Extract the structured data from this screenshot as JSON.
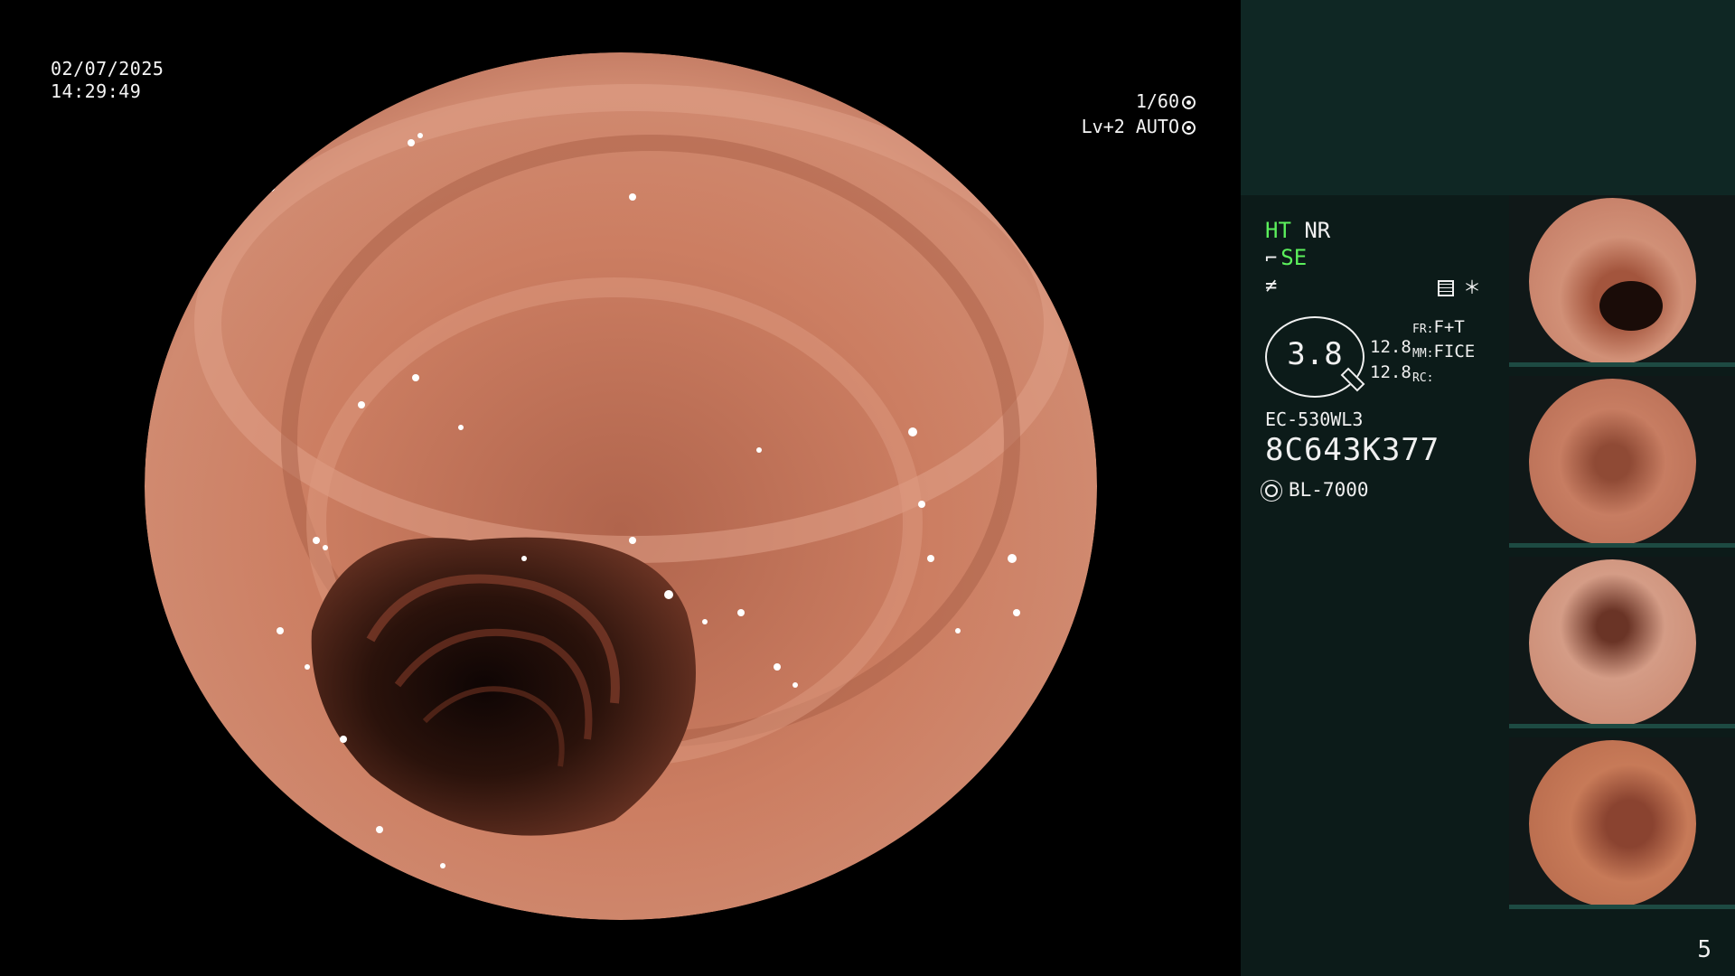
{
  "overlay": {
    "date": "02/07/2025",
    "time": "14:29:49",
    "shutter": "1/60",
    "level": "Lv+2",
    "mode": "AUTO"
  },
  "status": {
    "ht": "HT",
    "nr": "NR",
    "se": "SE",
    "lens_value": "3.8",
    "num_top": "12.8",
    "num_bottom": "12.8",
    "fr_label": "FR:",
    "fr_value": "F+T",
    "mm_label": "MM:",
    "mm_value": "FICE",
    "rc_label": "RC:"
  },
  "scope": {
    "model": "EC-530WL3",
    "serial": "8C643K377",
    "light_source": "BL-7000"
  },
  "icons": {
    "info": "menu-icon",
    "star": "asterisk-icon",
    "gear": "gear-icon",
    "sun": "light-icon"
  },
  "page_number": "5",
  "colors": {
    "panel_bg": "#0c1b19",
    "panel_top": "#0f2724",
    "accent_green": "#5cf05c",
    "mucosa": "#c97a60"
  }
}
